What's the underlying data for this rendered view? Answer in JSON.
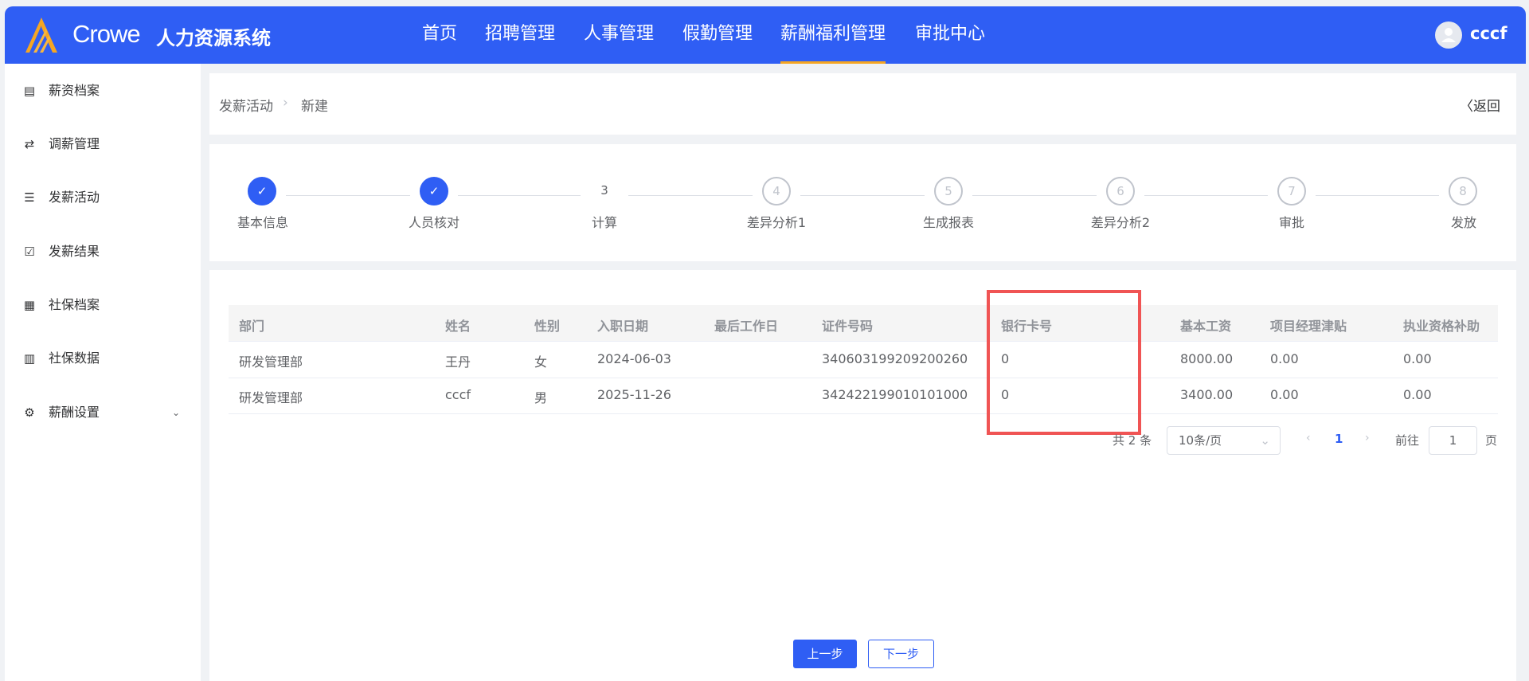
{
  "header": {
    "brand": "Crowe",
    "system": "人力资源系统",
    "nav": [
      "首页",
      "招聘管理",
      "人事管理",
      "假勤管理",
      "薪酬福利管理",
      "审批中心"
    ],
    "active": "薪酬福利管理",
    "user": "cccf",
    "colors": {
      "primary": "#2f5ef4",
      "active_underline": "#f5a623"
    }
  },
  "sidebar": {
    "items": [
      {
        "label": "薪资档案",
        "icon": "document-icon"
      },
      {
        "label": "调薪管理",
        "icon": "exchange-icon"
      },
      {
        "label": "发薪活动",
        "icon": "list-icon"
      },
      {
        "label": "发薪结果",
        "icon": "clipboard-check-icon"
      },
      {
        "label": "社保档案",
        "icon": "grid-icon"
      },
      {
        "label": "社保数据",
        "icon": "bar-chart-icon"
      },
      {
        "label": "薪酬设置",
        "icon": "gear-icon"
      }
    ]
  },
  "breadcrumb": {
    "parent": "发薪活动",
    "current": "新建",
    "back": "返回"
  },
  "steps": [
    {
      "n": "1",
      "label": "基本信息",
      "status": "done"
    },
    {
      "n": "2",
      "label": "人员核对",
      "status": "done"
    },
    {
      "n": "3",
      "label": "计算",
      "status": "current"
    },
    {
      "n": "4",
      "label": "差异分析1",
      "status": "todo"
    },
    {
      "n": "5",
      "label": "生成报表",
      "status": "todo"
    },
    {
      "n": "6",
      "label": "差异分析2",
      "status": "todo"
    },
    {
      "n": "7",
      "label": "审批",
      "status": "todo"
    },
    {
      "n": "8",
      "label": "发放",
      "status": "todo"
    }
  ],
  "table": {
    "columns": [
      "部门",
      "姓名",
      "性别",
      "入职日期",
      "最后工作日",
      "证件号码",
      "银行卡号",
      "基本工资",
      "项目经理津贴",
      "执业资格补助"
    ],
    "rows": [
      [
        "研发管理部",
        "王丹",
        "女",
        "2024-06-03",
        "",
        "340603199209200260",
        "0",
        "8000.00",
        "0.00",
        "0.00"
      ],
      [
        "研发管理部",
        "cccf",
        "男",
        "2025-11-26",
        "",
        "342422199010101000",
        "0",
        "3400.00",
        "0.00",
        "0.00"
      ]
    ]
  },
  "pagination": {
    "total": "共 2 条",
    "page_size": "10条/页",
    "current": "1",
    "goto_label": "前往",
    "goto_value": "1",
    "page_suffix": "页"
  },
  "footer": {
    "prev": "上一步",
    "next": "下一步"
  }
}
